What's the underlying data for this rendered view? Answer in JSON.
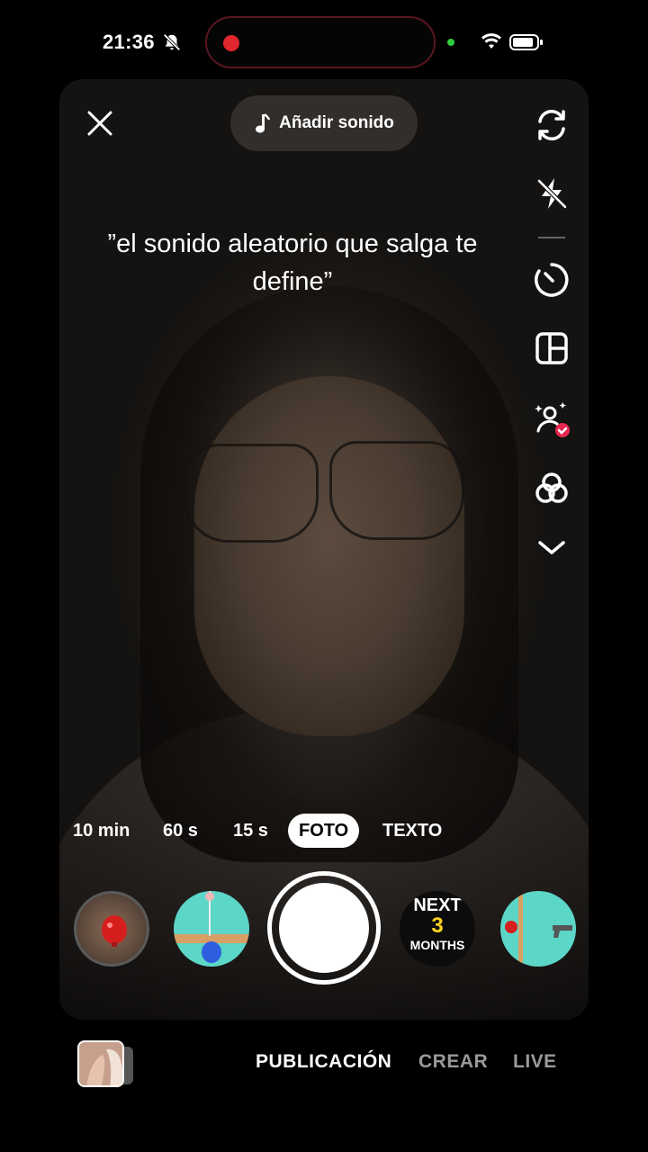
{
  "status_bar": {
    "time": "21:36"
  },
  "top": {
    "add_sound_label": "Añadir sonido"
  },
  "caption": {
    "text": "”el sonido aleatorio que salga te define”"
  },
  "right_toolbar": [
    "flip-camera-icon",
    "flash-off-icon",
    "timer-icon",
    "layout-icon",
    "effects-person-icon",
    "filters-icon",
    "expand-more-icon"
  ],
  "modes": [
    {
      "label": "10 min",
      "active": false
    },
    {
      "label": "60 s",
      "active": false
    },
    {
      "label": "15 s",
      "active": false
    },
    {
      "label": "FOTO",
      "active": true
    },
    {
      "label": "TEXTO",
      "active": false
    }
  ],
  "effects": {
    "next_months": {
      "line1": "NEXT",
      "line2": "3",
      "line3": "MONTHS"
    }
  },
  "bottom_nav": {
    "publicacion": "PUBLICACIÓN",
    "crear": "CREAR",
    "live": "LIVE"
  },
  "colors": {
    "record": "#e0262f",
    "mode_active_bg": "#ffffff",
    "nav_inactive": "#9a9a9a"
  }
}
